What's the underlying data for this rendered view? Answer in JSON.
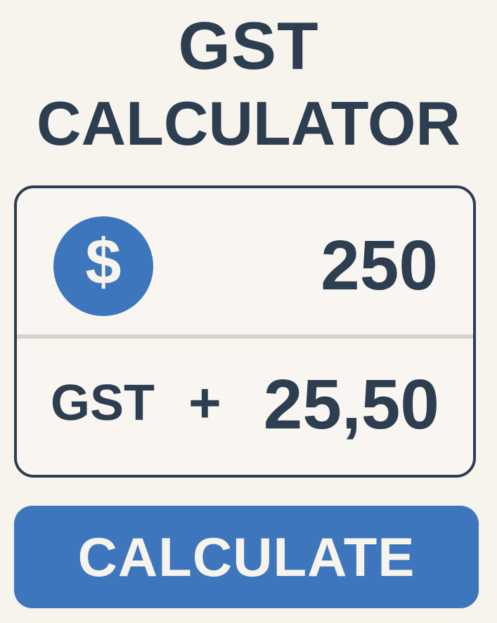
{
  "app": {
    "title_line1": "GST",
    "title_line2": "CALCULATOR"
  },
  "amount": {
    "currency_symbol": "$",
    "currency_icon": "dollar-icon",
    "value": "250"
  },
  "gst": {
    "label": "GST",
    "operator": "+",
    "value": "25,50"
  },
  "actions": {
    "calculate_label": "CALCULATE"
  },
  "colors": {
    "background": "#f7f3ed",
    "text": "#2c3e50",
    "accent": "#3e76be",
    "divider": "#d6d3cc"
  }
}
